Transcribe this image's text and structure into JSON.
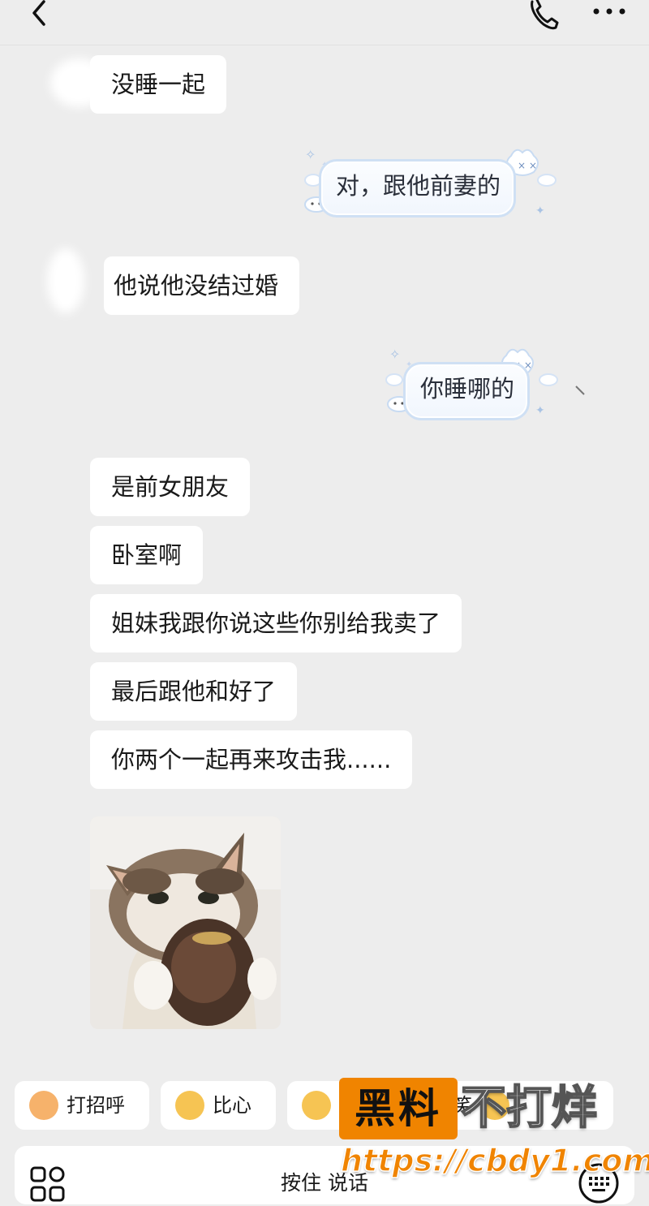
{
  "header": {
    "back_icon": "chevron-left-icon",
    "call_icon": "phone-icon",
    "more_icon": "more-dots-icon"
  },
  "messages": [
    {
      "side": "left",
      "type": "text",
      "text": "没睡一起"
    },
    {
      "side": "right",
      "type": "sticker-bubble",
      "text": "对，跟他前妻的"
    },
    {
      "side": "left",
      "type": "text",
      "text": "他说他没结过婚"
    },
    {
      "side": "right",
      "type": "sticker-bubble",
      "text": "你睡哪的"
    },
    {
      "side": "left",
      "type": "text",
      "text": "是前女朋友"
    },
    {
      "side": "left",
      "type": "text",
      "text": "卧室啊"
    },
    {
      "side": "left",
      "type": "text",
      "text": "姐妹我跟你说这些你别给我卖了"
    },
    {
      "side": "left",
      "type": "text",
      "text": "最后跟他和好了"
    },
    {
      "side": "left",
      "type": "text",
      "text": "你两个一起再来攻击我......"
    },
    {
      "side": "left",
      "type": "image",
      "image": "cat-eating-sticker"
    }
  ],
  "quick_replies": [
    {
      "label": "打招呼",
      "icon": "wave-emoji-icon"
    },
    {
      "label": "比心",
      "icon": "heart-hands-emoji-icon"
    },
    {
      "label": "",
      "icon": "thumbs-up-emoji-icon"
    },
    {
      "label": "笑",
      "icon": "laugh-emoji-icon"
    }
  ],
  "input": {
    "hold_to_talk": "按住 说话",
    "apps_icon": "grid-apps-icon",
    "keyboard_icon": "keyboard-icon"
  },
  "watermark": {
    "box_text": "黑料",
    "text": "不打烊",
    "url": "https://cbdy1.com"
  },
  "colors": {
    "background": "#ededed",
    "bubble": "#ffffff",
    "sticker_border": "#cfe0f4",
    "watermark_orange": "#f08400"
  }
}
